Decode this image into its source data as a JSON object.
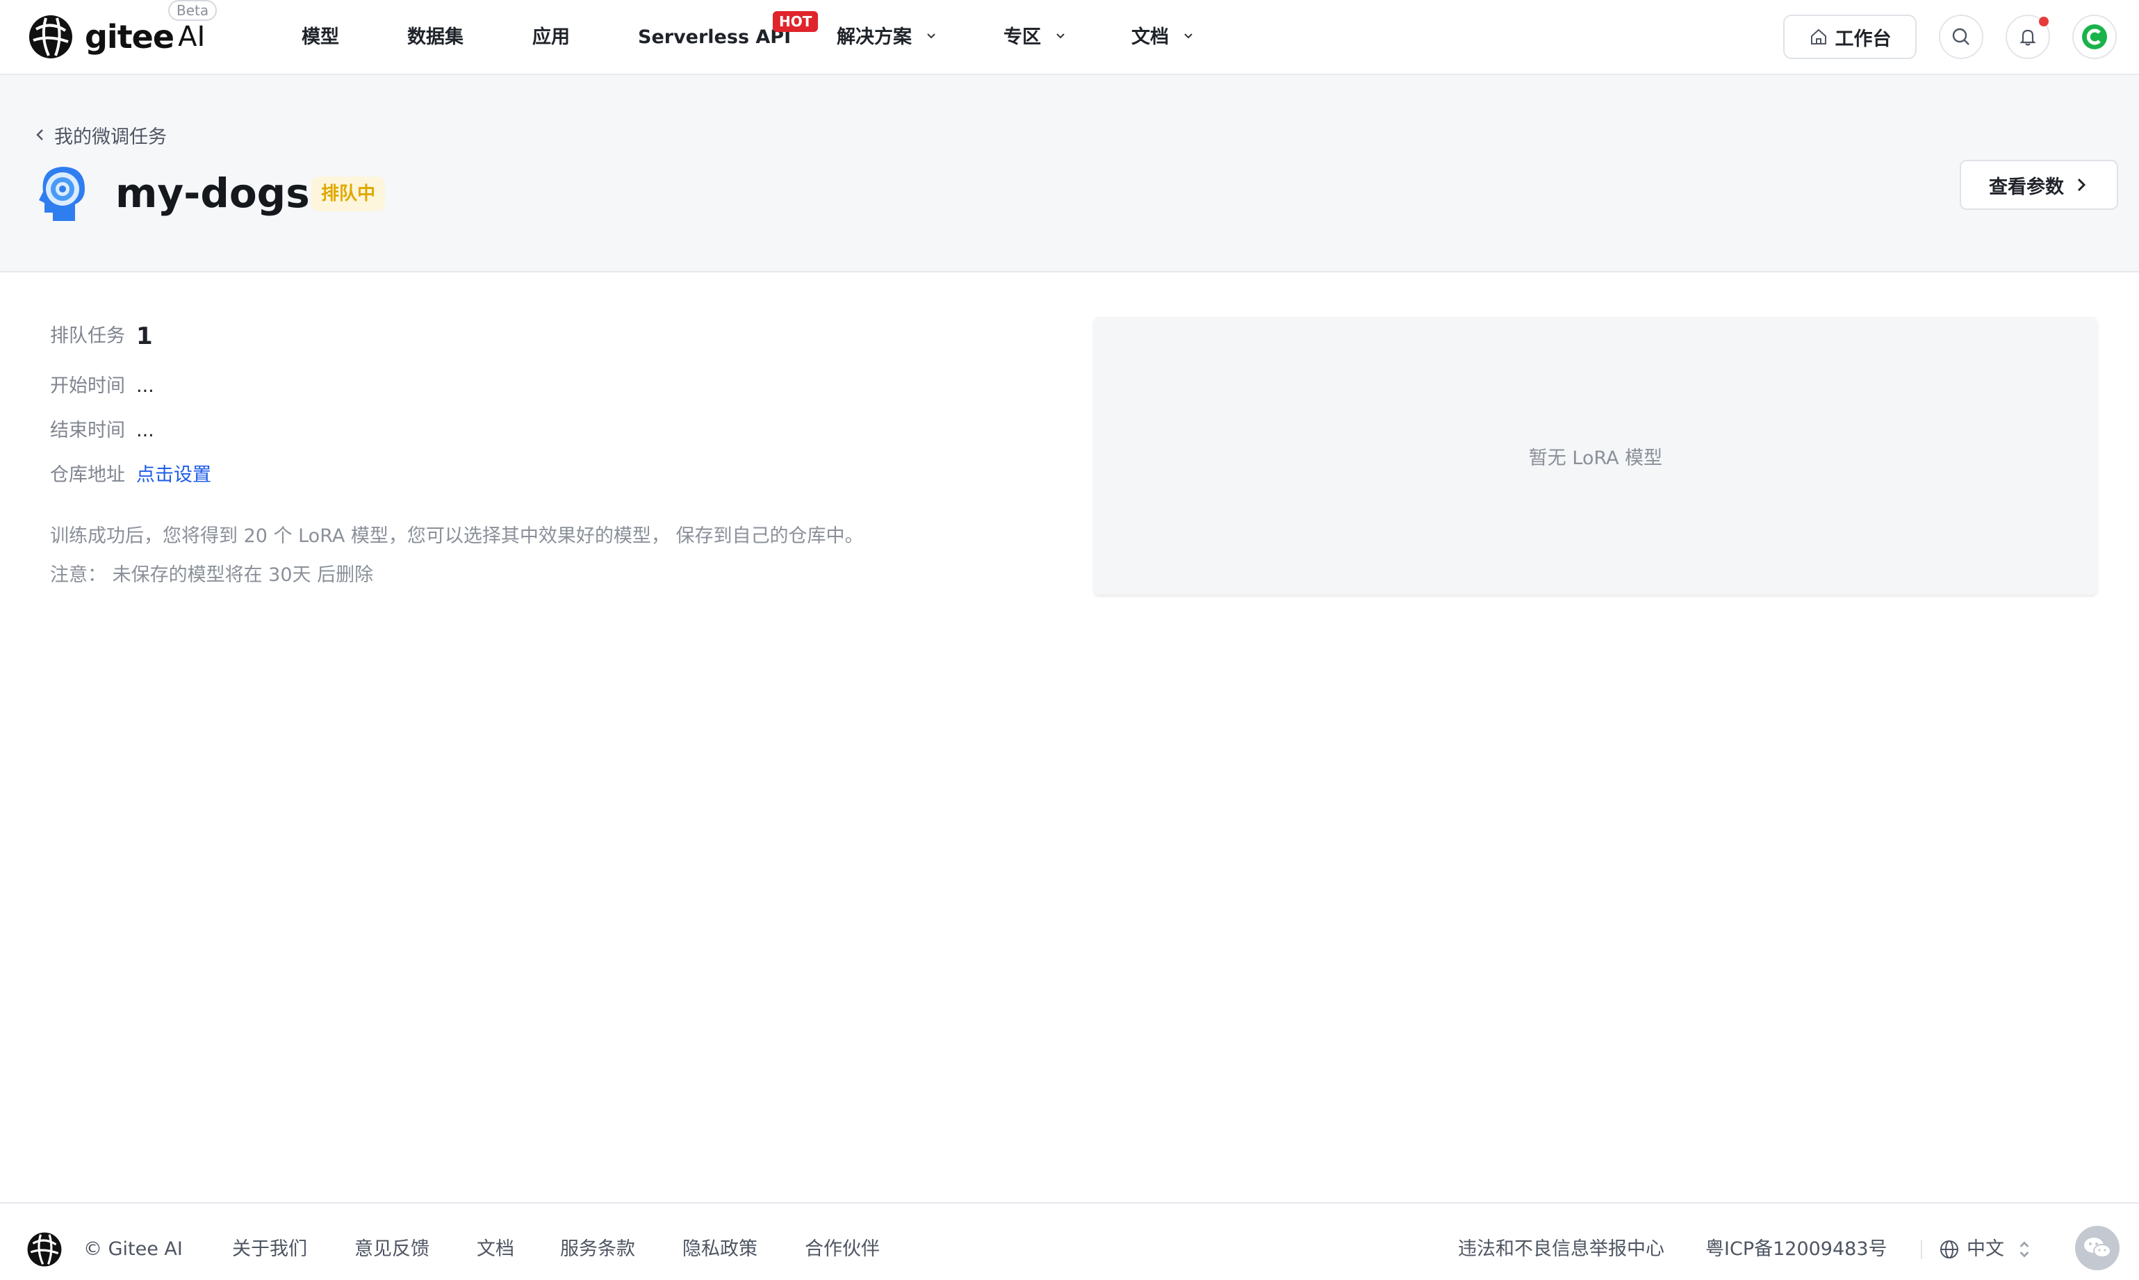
{
  "brand": {
    "name": "gitee",
    "suffix": "AI",
    "badge": "Beta"
  },
  "nav": {
    "items": [
      {
        "label": "模型"
      },
      {
        "label": "数据集"
      },
      {
        "label": "应用"
      },
      {
        "label": "Serverless API",
        "badge": "HOT"
      },
      {
        "label": "解决方案"
      },
      {
        "label": "专区"
      },
      {
        "label": "文档"
      }
    ],
    "workbench_label": "工作台"
  },
  "header": {
    "breadcrumb": "我的微调任务",
    "title": "my-dogs",
    "status": "排队中",
    "params_button": "查看参数"
  },
  "details": {
    "queue_label": "排队任务",
    "queue_value": "1",
    "start_label": "开始时间",
    "start_value": "...",
    "end_label": "结束时间",
    "end_value": "...",
    "repo_label": "仓库地址",
    "repo_link": "点击设置",
    "note_line1": "训练成功后，您将得到 20 个 LoRA 模型，您可以选择其中效果好的模型， 保存到自己的仓库中。",
    "note_line2": "注意： 未保存的模型将在 30天 后删除"
  },
  "lora_panel": {
    "empty_text": "暂无 LoRA 模型"
  },
  "footer": {
    "copyright": "© Gitee AI",
    "links": [
      "关于我们",
      "意见反馈",
      "文档",
      "服务条款",
      "隐私政策",
      "合作伙伴"
    ],
    "report": "违法和不良信息举报中心",
    "icp": "粤ICP备12009483号",
    "language": "中文"
  },
  "colors": {
    "accent": "#1e5de6",
    "status_text": "#e0a800",
    "status_bg": "#fdf6dc",
    "hot": "#e0242b"
  }
}
